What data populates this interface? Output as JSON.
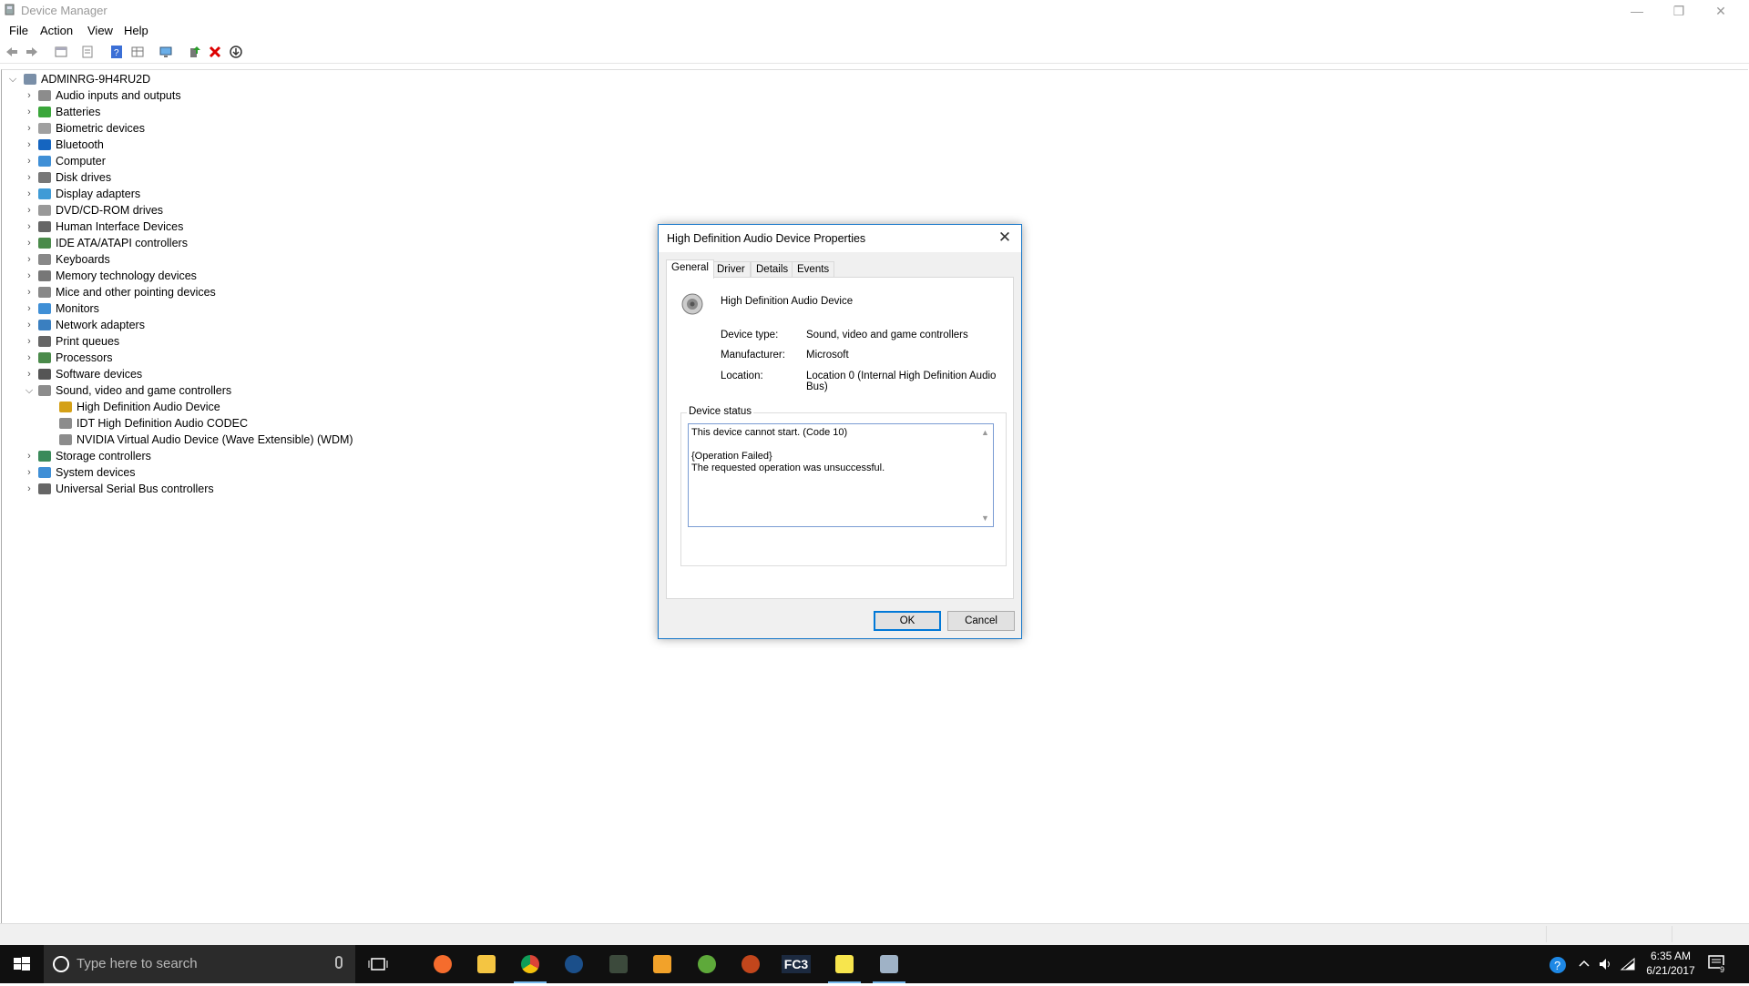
{
  "window": {
    "title": "Device Manager",
    "menu": [
      "File",
      "Action",
      "View",
      "Help"
    ]
  },
  "tree": {
    "root": "ADMINRG-9H4RU2D",
    "items": [
      {
        "label": "Audio inputs and outputs",
        "icon": "speaker-icon"
      },
      {
        "label": "Batteries",
        "icon": "battery-icon"
      },
      {
        "label": "Biometric devices",
        "icon": "fingerprint-icon"
      },
      {
        "label": "Bluetooth",
        "icon": "bluetooth-icon"
      },
      {
        "label": "Computer",
        "icon": "computer-icon"
      },
      {
        "label": "Disk drives",
        "icon": "disk-icon"
      },
      {
        "label": "Display adapters",
        "icon": "display-icon"
      },
      {
        "label": "DVD/CD-ROM drives",
        "icon": "dvd-icon"
      },
      {
        "label": "Human Interface Devices",
        "icon": "hid-icon"
      },
      {
        "label": "IDE ATA/ATAPI controllers",
        "icon": "ide-icon"
      },
      {
        "label": "Keyboards",
        "icon": "keyboard-icon"
      },
      {
        "label": "Memory technology devices",
        "icon": "memory-icon"
      },
      {
        "label": "Mice and other pointing devices",
        "icon": "mouse-icon"
      },
      {
        "label": "Monitors",
        "icon": "monitor-icon"
      },
      {
        "label": "Network adapters",
        "icon": "network-icon"
      },
      {
        "label": "Print queues",
        "icon": "printer-icon"
      },
      {
        "label": "Processors",
        "icon": "processor-icon"
      },
      {
        "label": "Software devices",
        "icon": "software-icon"
      },
      {
        "label": "Sound, video and game controllers",
        "icon": "speaker-icon",
        "expanded": true,
        "children": [
          {
            "label": "High Definition Audio Device",
            "icon": "warning-speaker-icon"
          },
          {
            "label": "IDT High Definition Audio CODEC",
            "icon": "speaker-icon"
          },
          {
            "label": "NVIDIA Virtual Audio Device (Wave Extensible) (WDM)",
            "icon": "speaker-icon"
          }
        ]
      },
      {
        "label": "Storage controllers",
        "icon": "storage-icon"
      },
      {
        "label": "System devices",
        "icon": "system-icon"
      },
      {
        "label": "Universal Serial Bus controllers",
        "icon": "usb-icon"
      }
    ]
  },
  "dialog": {
    "title": "High Definition Audio Device Properties",
    "tabs": [
      "General",
      "Driver",
      "Details",
      "Events"
    ],
    "active_tab": "General",
    "device_name": "High Definition Audio Device",
    "fields": [
      {
        "key": "Device type:",
        "value": "Sound, video and game controllers"
      },
      {
        "key": "Manufacturer:",
        "value": "Microsoft"
      },
      {
        "key": "Location:",
        "value": "Location 0 (Internal High Definition Audio Bus)"
      }
    ],
    "status_label": "Device status",
    "status_text": "This device cannot start. (Code 10)\n\n{Operation Failed}\nThe requested operation was unsuccessful.",
    "ok_label": "OK",
    "cancel_label": "Cancel"
  },
  "taskbar": {
    "search_placeholder": "Type here to search",
    "time": "6:35 AM",
    "date": "6/21/2017",
    "notification_count": "9",
    "apps": [
      "origin-icon",
      "file-explorer-icon",
      "chrome-icon",
      "steam-icon",
      "game-icon",
      "media-player-icon",
      "utorrent-icon",
      "game2-icon",
      "fc3-icon",
      "sticky-notes-icon",
      "device-manager-icon"
    ],
    "fc3_label": "FC3"
  },
  "colors": {
    "accent": "#0078d7",
    "taskbar": "#101010",
    "dialog_border": "#1979ca"
  }
}
